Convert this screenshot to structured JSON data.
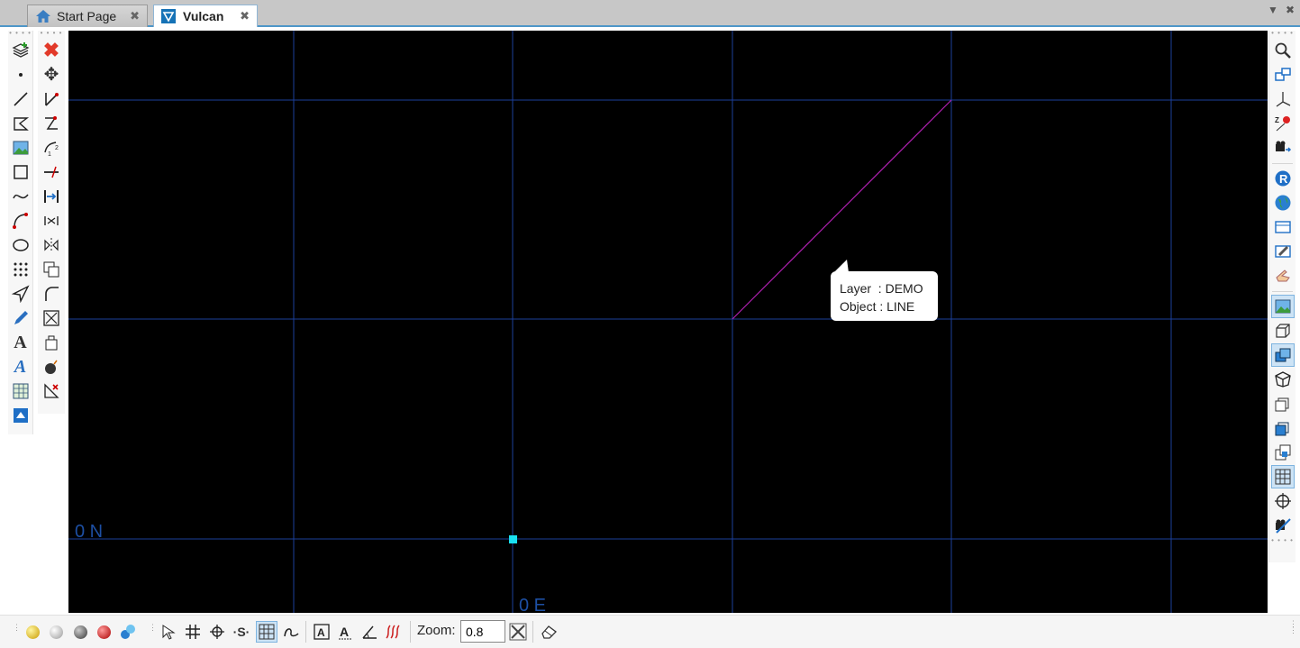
{
  "tabs": [
    {
      "label": "Start Page",
      "icon": "home-icon",
      "active": false
    },
    {
      "label": "Vulcan",
      "icon": "vulcan-logo-icon",
      "active": true
    }
  ],
  "toolbar_left_1": [
    "add-layer-icon",
    "point-icon",
    "line-icon",
    "polygon-icon",
    "image-icon",
    "rectangle-icon",
    "curve-icon",
    "arc-icon",
    "ellipse-icon",
    "grid-points-icon",
    "send-icon",
    "pen-icon",
    "text-icon",
    "styled-text-icon",
    "table-icon",
    "panel-icon"
  ],
  "toolbar_left_2": [
    "delete-icon",
    "move-icon",
    "scale-icon",
    "reshape-icon",
    "renumber-icon",
    "break-line-icon",
    "extend-icon",
    "mirror-icon",
    "flip-icon",
    "copy-icon",
    "fillet-icon",
    "fit-icon",
    "paste-icon",
    "bomb-icon",
    "measure-delete-icon"
  ],
  "toolbar_right": [
    "zoom-icon",
    "windows-icon",
    "axes-icon",
    "z-axis-icon",
    "camera-move-icon",
    "r-icon",
    "globe-icon",
    "window-icon",
    "edit-window-icon",
    "pointer-icon",
    "image-view-icon",
    "cube-icon",
    "layers-icon",
    "box-icon",
    "stack-icon",
    "stack-2-icon",
    "stack-3-icon",
    "grid-icon",
    "target-icon",
    "camera-off-icon"
  ],
  "canvas": {
    "north_label": "0 N",
    "east_label": "0 E",
    "tooltip": {
      "layer_line": "Layer  : DEMO",
      "object_line": "Object : LINE"
    },
    "colors": {
      "background": "#000000",
      "grid": "#1b3f9a",
      "line": "#b020b0",
      "origin": "#19e0f0"
    }
  },
  "bottom": {
    "zoom_label": "Zoom:",
    "zoom_value": "0.8"
  }
}
